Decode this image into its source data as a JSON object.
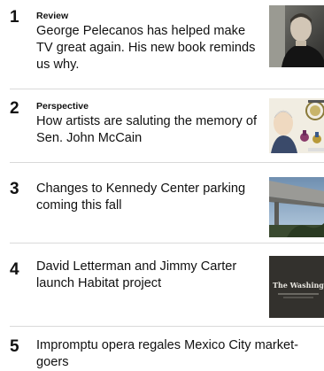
{
  "list": {
    "items": [
      {
        "rank": "1",
        "kicker": "Review",
        "headline": "George Pelecanos has helped make TV great again. His new book reminds us why.",
        "thumb_icon": "portrait-photo-icon"
      },
      {
        "rank": "2",
        "kicker": "Perspective",
        "headline": "How artists are saluting the memory of Sen. John McCain",
        "thumb_icon": "illustration-photo-icon"
      },
      {
        "rank": "3",
        "headline": "Changes to Kennedy Center parking coming this fall",
        "thumb_icon": "architecture-photo-icon"
      },
      {
        "rank": "4",
        "headline": "David Letterman and Jimmy Carter launch Habitat project",
        "thumb_icon": "video-thumbnail-icon",
        "thumb_caption": "The Washington Post"
      },
      {
        "rank": "5",
        "headline": "Impromptu opera regales Mexico City market-goers"
      }
    ]
  },
  "colors": {
    "text": "#111111",
    "divider": "#d9d9d9"
  }
}
